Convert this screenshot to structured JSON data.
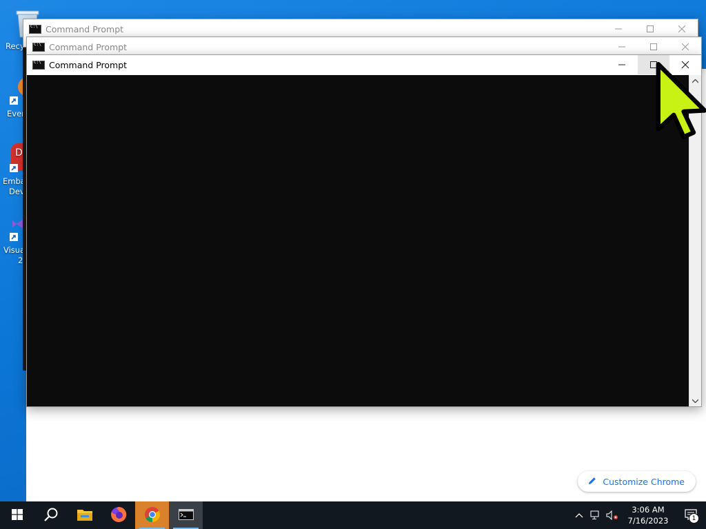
{
  "desktop": {
    "icons": [
      {
        "label": "Recy",
        "name": "recycle-bin"
      },
      {
        "label": "Ever",
        "name": "everything"
      },
      {
        "label": "Emba",
        "label2": "Dev",
        "name": "embarcadero-dev"
      },
      {
        "label": "Visua",
        "label2": "2",
        "name": "visual-studio"
      }
    ]
  },
  "chrome": {
    "customize_label": "Customize Chrome"
  },
  "windows": [
    {
      "title": "Command Prompt",
      "state": "inactive"
    },
    {
      "title": "Command Prompt",
      "state": "inactive"
    },
    {
      "title": "Command Prompt",
      "state": "active"
    }
  ],
  "taskbar": {
    "apps": [
      "start",
      "search",
      "file-explorer",
      "firefox",
      "chrome",
      "command-prompt"
    ],
    "clock_time": "3:06 AM",
    "clock_date": "7/16/2023",
    "notification_count": "1"
  },
  "colors": {
    "console_bg": "#0c0c0c",
    "taskbar_bg": "#111820",
    "cursor": "#c8f213",
    "accent": "#1a73e8"
  }
}
